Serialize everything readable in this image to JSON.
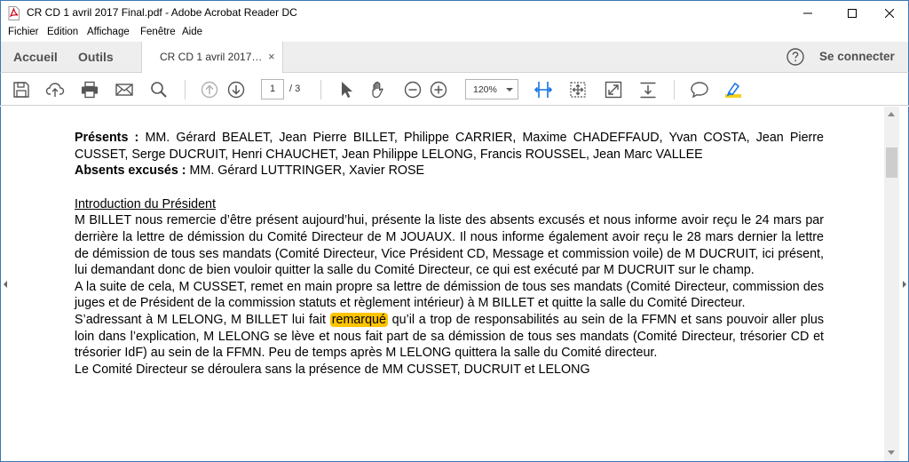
{
  "window": {
    "title": "CR CD 1 avril 2017 Final.pdf - Adobe Acrobat Reader DC",
    "minimize": "—",
    "close": "✕"
  },
  "menu": [
    "Fichier",
    "Edition",
    "Affichage",
    "Fenêtre",
    "Aide"
  ],
  "tabs": {
    "home": "Accueil",
    "tools": "Outils",
    "document": "CR CD 1 avril 2017…",
    "close": "×",
    "sign_in": "Se connecter"
  },
  "toolbar": {
    "page_current": "1",
    "page_total": "/ 3",
    "zoom": "120%",
    "icons": [
      "save-icon",
      "upload-icon",
      "print-icon",
      "mail-icon",
      "search-icon",
      "prev-page-icon",
      "next-page-icon",
      "select-cursor-icon",
      "hand-icon",
      "zoom-out-icon",
      "zoom-in-icon",
      "fit-width-icon",
      "scroll-mode-icon",
      "fullscreen-icon",
      "page-down-icon",
      "comment-icon",
      "highlight-icon"
    ]
  },
  "document": {
    "present_label": "Présents :",
    "present_text": "MM. Gérard BEALET, Jean Pierre BILLET, Philippe CARRIER, Maxime CHADEFFAUD, Yvan COSTA, Jean Pierre CUSSET, Serge DUCRUIT, Henri CHAUCHET, Jean Philippe LELONG, Francis ROUSSEL, Jean Marc VALLEE",
    "absent_label": "Absents excusés :",
    "absent_text": "MM. Gérard LUTTRINGER, Xavier ROSE",
    "section_title": "Introduction du Président",
    "para1": "M BILLET nous remercie d’être présent aujourd’hui, présente la liste des absents excusés et nous informe avoir reçu le 24 mars par derrière la lettre de démission du Comité Directeur de M JOUAUX. Il nous informe également avoir reçu le 28 mars dernier la lettre de démission de tous ses mandats (Comité Directeur, Vice Président CD, Message et commission voile) de M DUCRUIT, ici présent, lui demandant donc de bien vouloir quitter la salle du Comité Directeur, ce qui est exécuté par M DUCRUIT sur le champ.",
    "para2": "A la suite de cela, M CUSSET, remet en main propre sa lettre de démission de tous ses mandats (Comité Directeur, commission des juges et de Président de la commission statuts et règlement intérieur) à M BILLET et quitte la salle du Comité Directeur.",
    "para3_before": "S’adressant à M LELONG, M BILLET lui fait ",
    "para3_highlight": "remarqué",
    "para3_after": " qu’il a trop de responsabilités au sein de la FFMN et sans pouvoir aller plus loin dans l’explication, M LELONG se lève et nous fait part de sa démission de tous ses mandats (Comité Directeur, trésorier CD et trésorier IdF) au sein de la FFMN. Peu de temps après M LELONG quittera la salle du Comité directeur.",
    "para4": "Le Comité Directeur se déroulera sans la présence de MM CUSSET, DUCRUIT et LELONG"
  },
  "colors": {
    "highlight": "#ffc400",
    "accent": "#1473e6",
    "window_border": "#3c78b4"
  }
}
